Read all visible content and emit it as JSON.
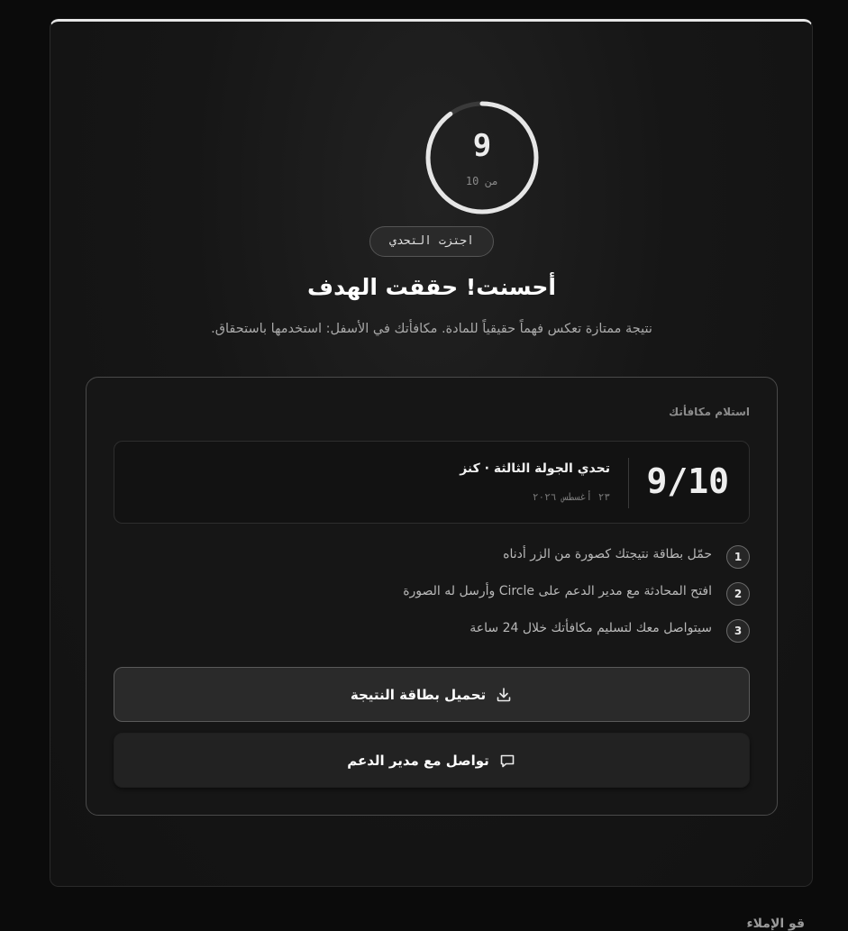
{
  "score": {
    "value": "9",
    "out_of_label": "من 10",
    "progress": 0.9
  },
  "badge": {
    "label": "اجتزت التحدي"
  },
  "headline": "أحسنت! حققت الهدف",
  "subline": "نتيجة ممتازة تعكس فهماً حقيقياً للمادة. مكافأتك في الأسفل: استخدمها باستحقاق.",
  "reward": {
    "label": "استلام مكافأتك",
    "result": {
      "score": "9/10",
      "title": "تحدي الجولة الثالثة · كنز",
      "date": "٢٣ أغسطس ٢٠٢٦"
    },
    "steps": [
      {
        "num": "1",
        "text": "حمّل بطاقة نتيجتك كصورة من الزر أدناه"
      },
      {
        "num": "2",
        "text": "افتح المحادثة مع مدير الدعم على Circle وأرسل له الصورة"
      },
      {
        "num": "3",
        "text": "سيتواصل معك لتسليم مكافأتك خلال 24 ساعة"
      }
    ],
    "download_button": {
      "label": "تحميل بطاقة النتيجة",
      "icon": "download-icon"
    },
    "support_button": {
      "label": "تواصل مع مدير الدعم",
      "icon": "chat-icon"
    }
  },
  "footer_peek": "قو الإملاء",
  "colors": {
    "background": "#0b0b0b",
    "card": "#161616",
    "ring": "#e6e6e6",
    "ring_track": "#3a3a3a"
  }
}
